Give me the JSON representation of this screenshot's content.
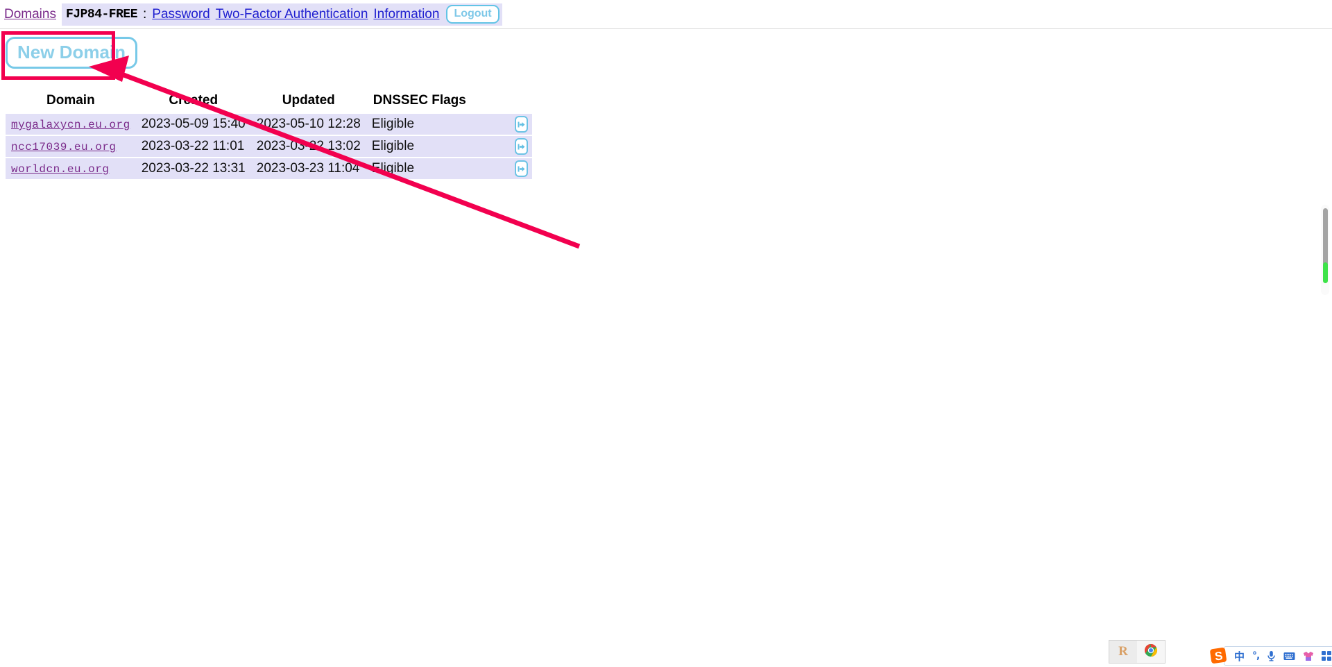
{
  "navbar": {
    "domains_link": "Domains",
    "account_id": "FJP84-FREE",
    "separator": ":",
    "password_link": "Password",
    "twofactor_link": "Two-Factor Authentication",
    "information_link": "Information",
    "logout_label": "Logout"
  },
  "actions": {
    "new_domain_label": "New Domain"
  },
  "annotation": {
    "color": "#f2004f",
    "target": "new-domain-button"
  },
  "table": {
    "headers": [
      "Domain",
      "Created",
      "Updated",
      "DNSSEC Flags"
    ],
    "rows": [
      {
        "domain": "mygalaxycn.eu.org",
        "created": "2023-05-09 15:40",
        "updated": "2023-05-10 12:28",
        "dnssec": "Eligible",
        "action_icon": "enter-arrow-icon"
      },
      {
        "domain": "ncc17039.eu.org",
        "created": "2023-03-22 11:01",
        "updated": "2023-03-22 13:02",
        "dnssec": "Eligible",
        "action_icon": "enter-arrow-icon"
      },
      {
        "domain": "worldcn.eu.org",
        "created": "2023-03-22 13:31",
        "updated": "2023-03-23 11:04",
        "dnssec": "Eligible",
        "action_icon": "enter-arrow-icon"
      }
    ]
  },
  "tray": {
    "r_label": "R",
    "chrome_icon": "chrome-icon"
  },
  "ime": {
    "logo": "sogou-logo-icon",
    "language_label": "中",
    "punctuation_label": "°,",
    "mic_icon": "microphone-icon",
    "keyboard_icon": "keyboard-icon",
    "skin_icon": "skin-shirt-icon",
    "apps_icon": "apps-grid-icon"
  },
  "colors": {
    "accent_cyan": "#77c9e8",
    "link_blue": "#2020d0",
    "link_visited": "#7a2a8a",
    "row_bg": "#e2e0f7",
    "annotation_pink": "#f2004f",
    "scroll_marker_green": "#3ee349"
  }
}
